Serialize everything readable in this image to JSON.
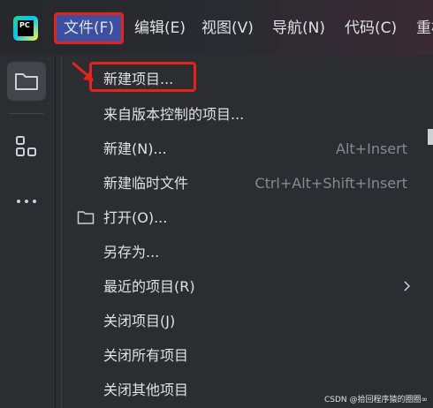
{
  "titlebar": {
    "logo_text": "PC",
    "menus": [
      {
        "label": "文件(F)",
        "active": true
      },
      {
        "label": "编辑(E)"
      },
      {
        "label": "视图(V)"
      },
      {
        "label": "导航(N)"
      },
      {
        "label": "代码(C)"
      },
      {
        "label": "重构"
      }
    ]
  },
  "sidebar": {
    "icons": [
      "folder-icon",
      "structure-icon",
      "more-icon"
    ]
  },
  "file_menu": {
    "items": [
      {
        "label": "新建项目...",
        "shortcut": ""
      },
      {
        "label": "来自版本控制的项目...",
        "shortcut": ""
      },
      {
        "label": "新建(N)...",
        "shortcut": "Alt+Insert"
      },
      {
        "label": "新建临时文件",
        "shortcut": "Ctrl+Alt+Shift+Insert"
      },
      {
        "label": "打开(O)...",
        "shortcut": ""
      },
      {
        "label": "另存为...",
        "shortcut": ""
      },
      {
        "label": "最近的项目(R)",
        "shortcut": ""
      },
      {
        "label": "关闭项目(J)",
        "shortcut": ""
      },
      {
        "label": "关闭所有项目",
        "shortcut": ""
      },
      {
        "label": "关闭其他项目",
        "shortcut": ""
      }
    ]
  },
  "watermark": "CSDN @拾回程序猿的圈圈∞",
  "colors": {
    "annotation_red": "#e3241c",
    "menu_active_bg": "#3c4fa0",
    "text": "#dfe1e5",
    "shortcut_text": "#868a91"
  }
}
